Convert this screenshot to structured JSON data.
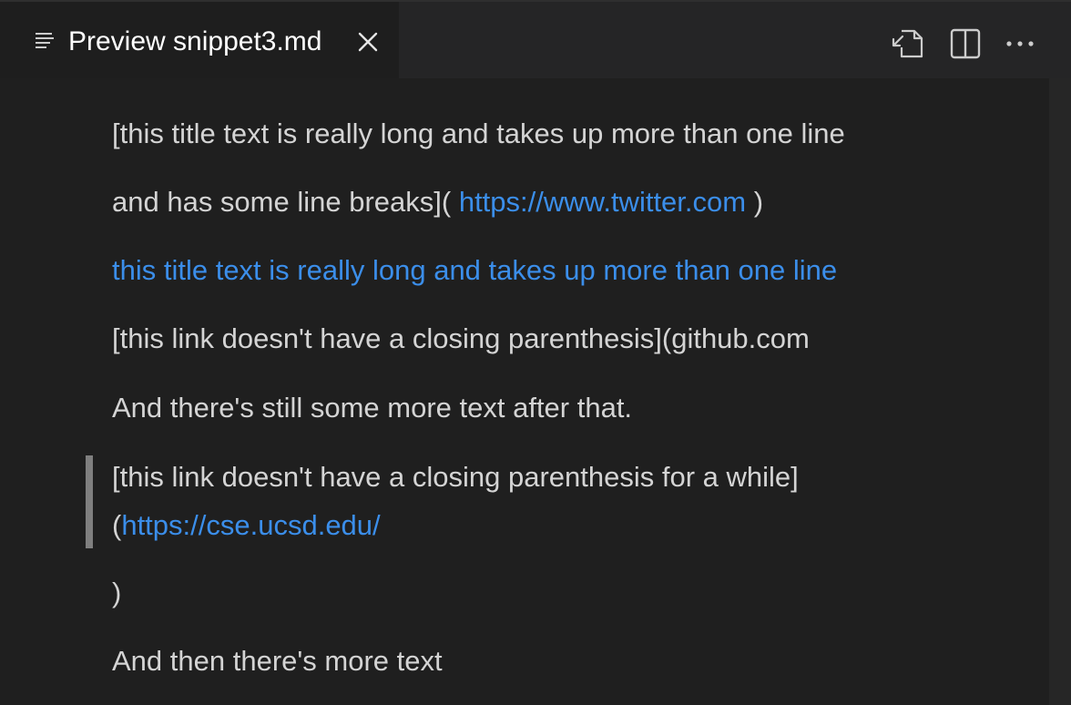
{
  "tab": {
    "icon": "preview-lines-icon",
    "title": "Preview snippet3.md",
    "close_icon": "close-icon"
  },
  "actions": [
    {
      "name": "open-source-icon"
    },
    {
      "name": "split-editor-icon"
    },
    {
      "name": "more-actions-icon"
    }
  ],
  "content": {
    "line1": "[this title text is really long and takes up more than one line",
    "line2_prefix": "and has some line breaks](",
    "line2_link": "https://www.twitter.com",
    "line2_suffix": ")",
    "line3_link": "this title text is really long and takes up more than one line",
    "line4": "[this link doesn't have a closing parenthesis](github.com",
    "line5": "And there's still some more text after that.",
    "quote_line1": "[this link doesn't have a closing parenthesis for a while]",
    "quote_line2_prefix": "(",
    "quote_line2_link": "https://cse.ucsd.edu/",
    "line7": ")",
    "line8": "And then there's more text"
  },
  "colors": {
    "background": "#1f1f1f",
    "text": "#d4d4d4",
    "link": "#3b8eea",
    "quote_bar": "#7f7f7f"
  }
}
